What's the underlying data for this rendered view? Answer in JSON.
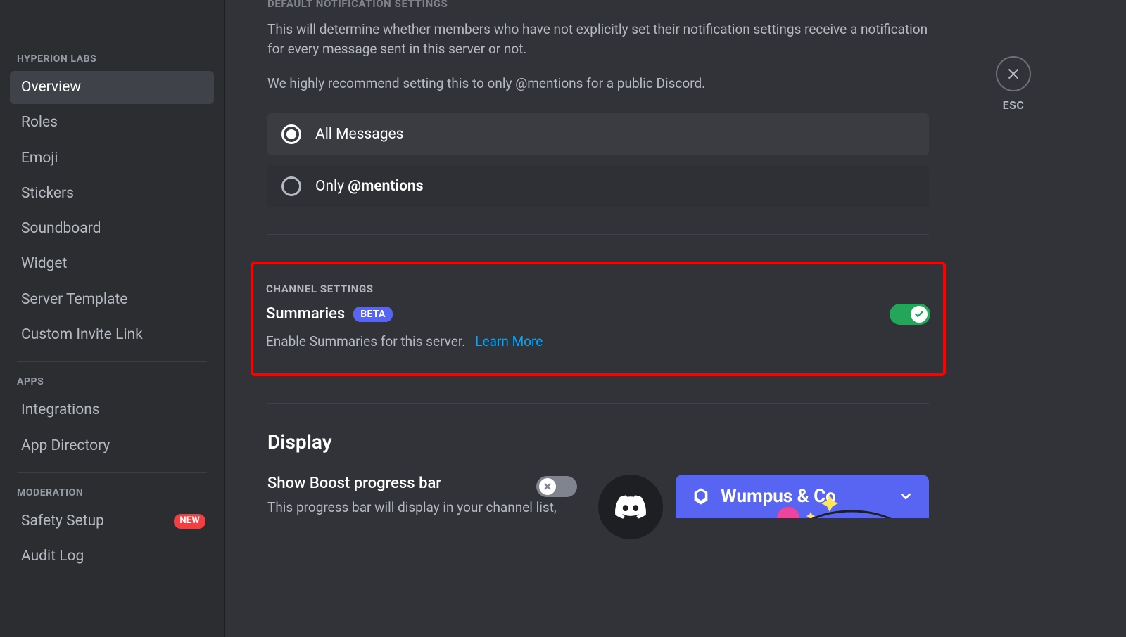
{
  "sidebar": {
    "server_name": "HYPERION LABS",
    "groups": {
      "server": {
        "items": [
          {
            "label": "Overview",
            "selected": true
          },
          {
            "label": "Roles"
          },
          {
            "label": "Emoji"
          },
          {
            "label": "Stickers"
          },
          {
            "label": "Soundboard"
          },
          {
            "label": "Widget"
          },
          {
            "label": "Server Template"
          },
          {
            "label": "Custom Invite Link"
          }
        ]
      },
      "apps": {
        "label": "APPS",
        "items": [
          {
            "label": "Integrations"
          },
          {
            "label": "App Directory"
          }
        ]
      },
      "moderation": {
        "label": "MODERATION",
        "items": [
          {
            "label": "Safety Setup",
            "badge": "NEW"
          },
          {
            "label": "Audit Log"
          }
        ]
      }
    }
  },
  "close": {
    "label": "ESC"
  },
  "notification": {
    "heading": "DEFAULT NOTIFICATION SETTINGS",
    "desc1": "This will determine whether members who have not explicitly set their notification settings receive a notification for every message sent in this server or not.",
    "desc2": "We highly recommend setting this to only @mentions for a public Discord.",
    "options": {
      "all": {
        "label": "All Messages",
        "selected": true
      },
      "mentions": {
        "prefix": "Only ",
        "bold": "@mentions",
        "selected": false
      }
    }
  },
  "channel_settings": {
    "heading": "CHANNEL SETTINGS",
    "title": "Summaries",
    "badge": "BETA",
    "desc": "Enable Summaries for this server.",
    "link_label": "Learn More",
    "enabled": true
  },
  "display": {
    "heading": "Display",
    "boost": {
      "title": "Show Boost progress bar",
      "desc": "This progress bar will display in your channel list,",
      "enabled": false
    },
    "preview": {
      "server_name": "Wumpus & Co"
    }
  }
}
